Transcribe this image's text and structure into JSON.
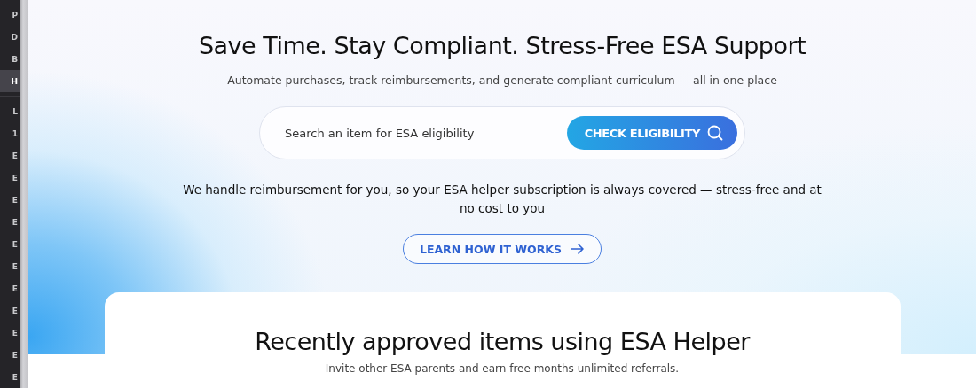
{
  "sidebar": {
    "items": [
      {
        "label": "P",
        "selected": false
      },
      {
        "label": "D",
        "selected": false
      },
      {
        "label": "B",
        "selected": false
      },
      {
        "label": "H",
        "selected": true
      }
    ],
    "items_below": [
      "L",
      "1",
      "E",
      "E",
      "E",
      "E",
      "E",
      "E",
      "E",
      "E",
      "E",
      "E",
      "E"
    ]
  },
  "hero": {
    "title": "Save Time. Stay Compliant. Stress-Free ESA Support",
    "subtitle": "Automate purchases, track reimbursements, and generate compliant curriculum — all in one place",
    "search": {
      "placeholder": "Search an item for ESA eligibility",
      "button": "CHECK ELIGIBILITY"
    },
    "note": "We handle reimbursement for you, so your ESA helper subscription is always covered — stress-free and at no cost to you",
    "link_button": "LEARN HOW IT WORKS"
  },
  "card": {
    "title": "Recently approved items using ESA Helper",
    "subtitle": "Invite other ESA parents and earn free months unlimited referrals."
  }
}
